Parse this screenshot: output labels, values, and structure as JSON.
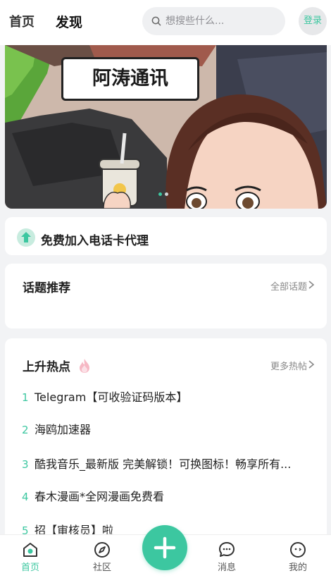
{
  "header": {
    "tabs": [
      {
        "label": "首页",
        "active": false
      },
      {
        "label": "发现",
        "active": true
      }
    ],
    "search": {
      "placeholder": "想搜些什么..."
    },
    "login_label": "登录"
  },
  "banner": {
    "sign_text": "阿涛通讯",
    "slide_count": 2,
    "active_slide": 1
  },
  "agent_card": {
    "label": "免费加入电话卡代理",
    "icon": "arrow-up-icon"
  },
  "topics": {
    "title": "话题推荐",
    "more_label": "全部话题"
  },
  "hot": {
    "title": "上升热点",
    "title_icon": "flame-icon",
    "more_label": "更多热帖",
    "items": [
      {
        "rank": "1",
        "text": "Telegram【可收验证码版本】"
      },
      {
        "rank": "2",
        "text": "海鸥加速器"
      },
      {
        "rank": "3",
        "text": "酷我音乐_最新版 完美解锁！可换图标！畅享所有..."
      },
      {
        "rank": "4",
        "text": "春木漫画*全网漫画免费看"
      },
      {
        "rank": "5",
        "text": "招【审核员】啦"
      }
    ]
  },
  "bottom_nav": {
    "items": [
      {
        "label": "首页",
        "icon": "home-icon",
        "active": true
      },
      {
        "label": "社区",
        "icon": "compass-icon",
        "active": false
      },
      {
        "label": "消息",
        "icon": "message-icon",
        "active": false
      },
      {
        "label": "我的",
        "icon": "profile-icon",
        "active": false
      }
    ],
    "center_icon": "plus-icon"
  },
  "colors": {
    "accent": "#3cc7a0",
    "background": "#f2f3f5",
    "card": "#ffffff"
  }
}
